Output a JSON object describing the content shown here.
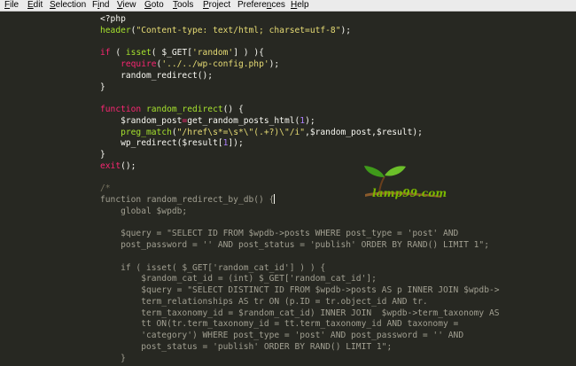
{
  "menubar": {
    "items": [
      {
        "label": "File",
        "accel": "F"
      },
      {
        "label": "Edit",
        "accel": "E"
      },
      {
        "label": "Selection",
        "accel": "S"
      },
      {
        "label": "Find",
        "accel": "i"
      },
      {
        "label": "View",
        "accel": "V"
      },
      {
        "label": "Goto",
        "accel": "G"
      },
      {
        "label": "Tools",
        "accel": "T"
      },
      {
        "label": "Project",
        "accel": "P"
      },
      {
        "label": "Preferences",
        "accel": "n"
      },
      {
        "label": "Help",
        "accel": "H"
      }
    ]
  },
  "editor": {
    "lines": [
      [
        {
          "t": "<?php",
          "c": "plain"
        }
      ],
      [
        {
          "t": "header",
          "c": "fn"
        },
        {
          "t": "(",
          "c": "plain"
        },
        {
          "t": "\"Content-type: text/html; charset=utf-8\"",
          "c": "str"
        },
        {
          "t": ");",
          "c": "plain"
        }
      ],
      [],
      [
        {
          "t": "if",
          "c": "kw"
        },
        {
          "t": " ( ",
          "c": "plain"
        },
        {
          "t": "isset",
          "c": "fn"
        },
        {
          "t": "( $_GET[",
          "c": "plain"
        },
        {
          "t": "'random'",
          "c": "str"
        },
        {
          "t": "] ) ){",
          "c": "plain"
        }
      ],
      [
        {
          "t": "    ",
          "c": "plain"
        },
        {
          "t": "require",
          "c": "kw"
        },
        {
          "t": "(",
          "c": "plain"
        },
        {
          "t": "'../../wp-config.php'",
          "c": "str"
        },
        {
          "t": ");",
          "c": "plain"
        }
      ],
      [
        {
          "t": "    random_redirect();",
          "c": "plain"
        }
      ],
      [
        {
          "t": "}",
          "c": "plain"
        }
      ],
      [],
      [
        {
          "t": "function",
          "c": "kw"
        },
        {
          "t": " ",
          "c": "plain"
        },
        {
          "t": "random_redirect",
          "c": "fn"
        },
        {
          "t": "() {",
          "c": "plain"
        }
      ],
      [
        {
          "t": "    $random_post",
          "c": "plain"
        },
        {
          "t": "=",
          "c": "kw"
        },
        {
          "t": "get_random_posts_html(",
          "c": "plain"
        },
        {
          "t": "1",
          "c": "num"
        },
        {
          "t": ");",
          "c": "plain"
        }
      ],
      [
        {
          "t": "    ",
          "c": "plain"
        },
        {
          "t": "preg_match",
          "c": "fn"
        },
        {
          "t": "(",
          "c": "plain"
        },
        {
          "t": "\"/href\\s*=\\s*\\\"(.+?)\\\"/i\"",
          "c": "str"
        },
        {
          "t": ",$random_post,$result);",
          "c": "plain"
        }
      ],
      [
        {
          "t": "    wp_redirect($result[",
          "c": "plain"
        },
        {
          "t": "1",
          "c": "num"
        },
        {
          "t": "]);",
          "c": "plain"
        }
      ],
      [
        {
          "t": "}",
          "c": "plain"
        }
      ],
      [
        {
          "t": "exit",
          "c": "kw"
        },
        {
          "t": "();",
          "c": "plain"
        }
      ],
      [],
      [
        {
          "t": "/*",
          "c": "comment"
        }
      ],
      [
        {
          "t": "function random_redirect_by_db() {",
          "c": "dim",
          "cursor": true
        }
      ],
      [
        {
          "t": "    global $wpdb;",
          "c": "dim"
        }
      ],
      [],
      [
        {
          "t": "    $query = \"SELECT ID FROM $wpdb->posts WHERE post_type = 'post' AND",
          "c": "dim"
        }
      ],
      [
        {
          "t": "    post_password = '' AND post_status = 'publish' ORDER BY RAND() LIMIT 1\";",
          "c": "dim"
        }
      ],
      [],
      [
        {
          "t": "    if ( isset( $_GET['random_cat_id'] ) ) {",
          "c": "dim"
        }
      ],
      [
        {
          "t": "        $random_cat_id = (int) $_GET['random_cat_id'];",
          "c": "dim"
        }
      ],
      [
        {
          "t": "        $query = \"SELECT DISTINCT ID FROM $wpdb->posts AS p INNER JOIN $wpdb->",
          "c": "dim"
        }
      ],
      [
        {
          "t": "        term_relationships AS tr ON (p.ID = tr.object_id AND tr.",
          "c": "dim"
        }
      ],
      [
        {
          "t": "        term_taxonomy_id = $random_cat_id) INNER JOIN  $wpdb->term_taxonomy AS",
          "c": "dim"
        }
      ],
      [
        {
          "t": "        tt ON(tr.term_taxonomy_id = tt.term_taxonomy_id AND taxonomy =",
          "c": "dim"
        }
      ],
      [
        {
          "t": "        'category') WHERE post_type = 'post' AND post_password = '' AND",
          "c": "dim"
        }
      ],
      [
        {
          "t": "        post_status = 'publish' ORDER BY RAND() LIMIT 1\";",
          "c": "dim"
        }
      ],
      [
        {
          "t": "    }",
          "c": "dim"
        }
      ]
    ]
  },
  "watermark": {
    "text": "lamp99.com",
    "colors": {
      "leaf": "#3f9a1a",
      "sprout": "#6cbf2a",
      "stem": "#8a5a2b",
      "text": "#7ab800"
    }
  },
  "colors": {
    "background": "#272822",
    "menubar": "#ebebeb",
    "keyword": "#f92672",
    "function": "#a6e22e",
    "string": "#e6db74",
    "number": "#ae81ff",
    "comment": "#75715e"
  }
}
